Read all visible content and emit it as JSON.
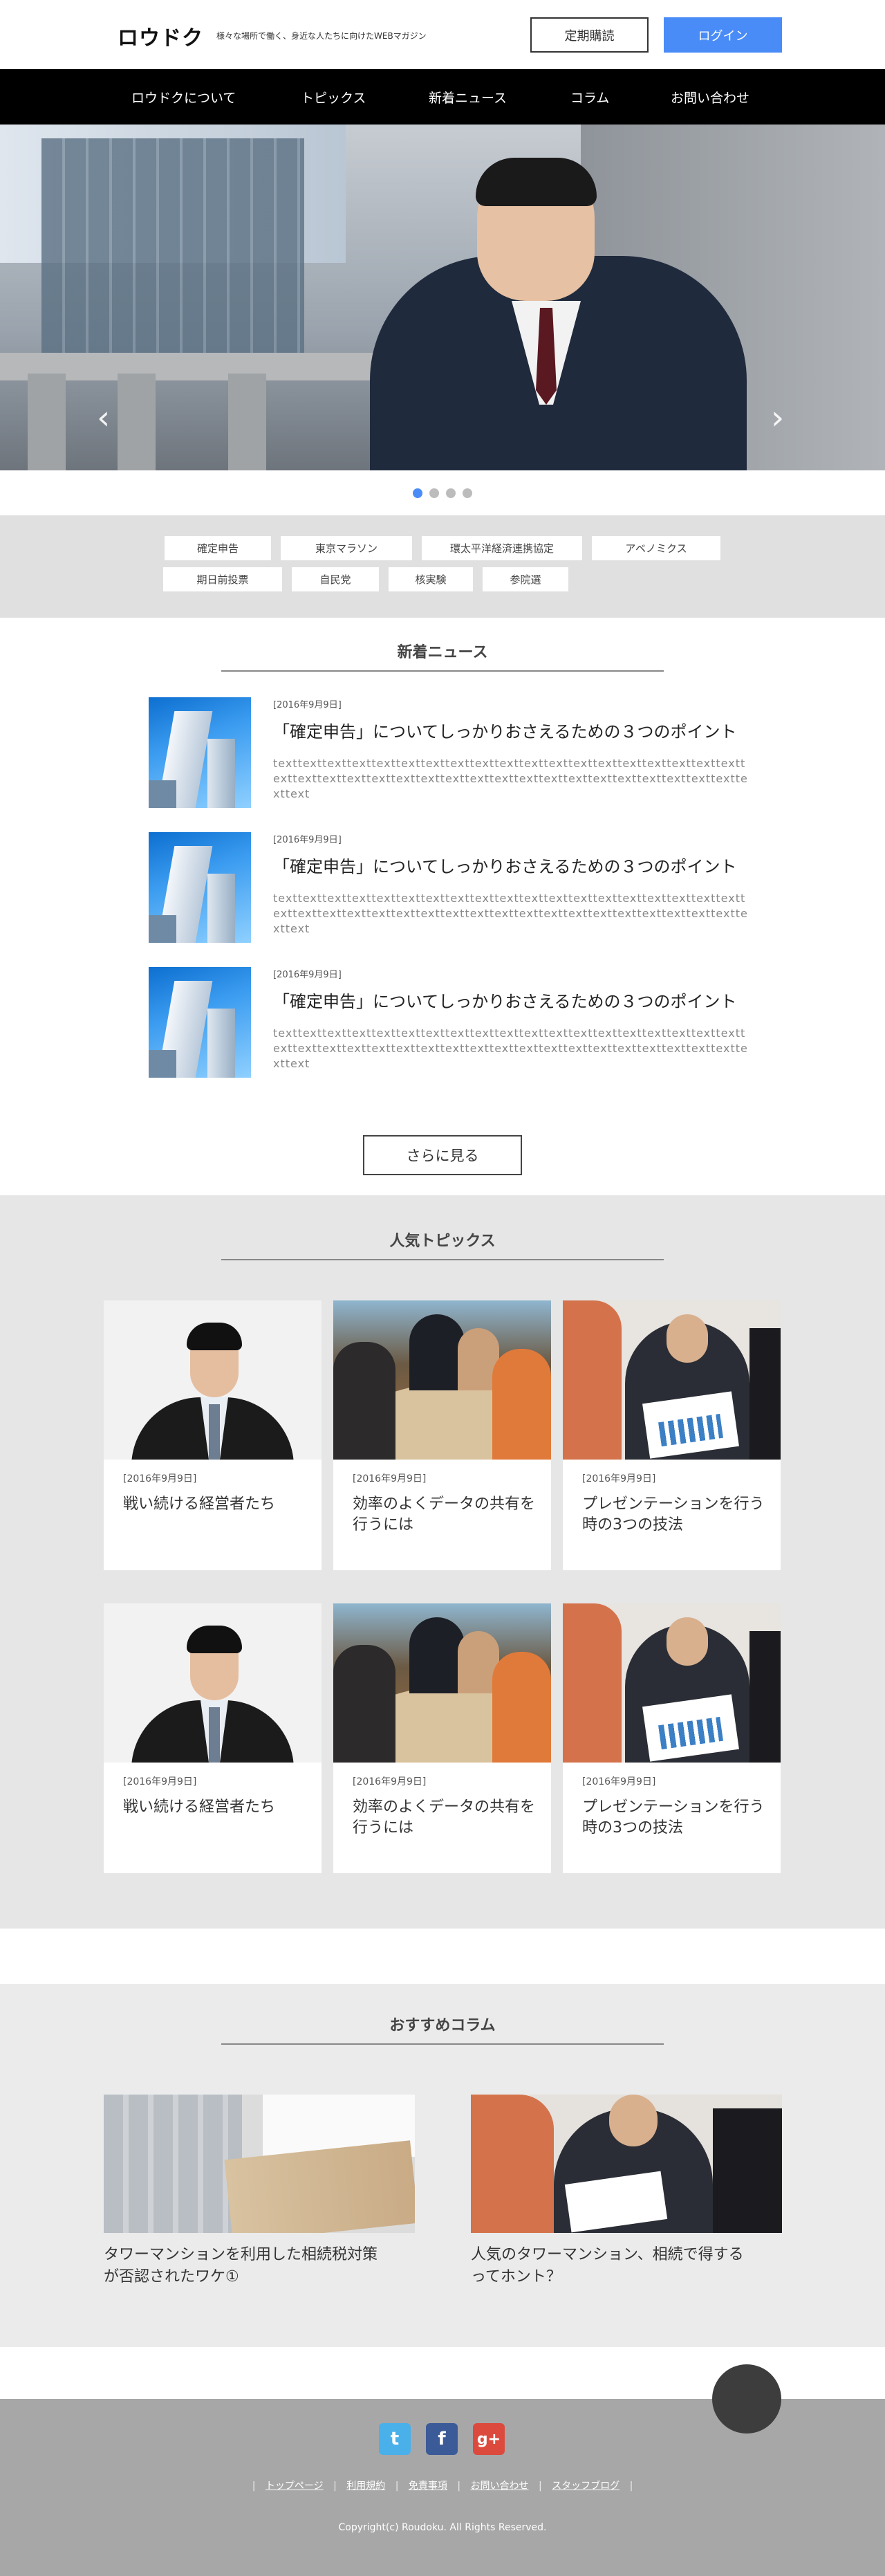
{
  "header": {
    "logo": "ロウドク",
    "tagline": "様々な場所で働く、身近な人たちに向けたWEBマガジン",
    "subscribe_label": "定期購読",
    "login_label": "ログイン"
  },
  "nav": {
    "items": [
      "ロウドクについて",
      "トピックス",
      "新着ニュース",
      "コラム",
      "お問い合わせ"
    ]
  },
  "hero": {
    "prev_glyph": "‹",
    "next_glyph": "›",
    "slide_count": 4,
    "active_slide": 1
  },
  "tags": {
    "row1": [
      "確定申告",
      "東京マラソン",
      "環太平洋経済連携協定",
      "アベノミクス"
    ],
    "row2": [
      "期日前投票",
      "自民党",
      "核実験",
      "参院選"
    ]
  },
  "news": {
    "title": "新着ニュース",
    "items": [
      {
        "date": "[2016年9月9日]",
        "title": "「確定申告」についてしっかりおさえるための３つのポイント",
        "body": "texttexttexttexttexttexttexttexttexttexttexttexttexttexttexttexttexttexttexttexttexttexttexttexttexttexttexttexttexttexttexttexttexttexttexttexttexttexttexttext"
      },
      {
        "date": "[2016年9月9日]",
        "title": "「確定申告」についてしっかりおさえるための３つのポイント",
        "body": "texttexttexttexttexttexttexttexttexttexttexttexttexttexttexttexttexttexttexttexttexttexttexttexttexttexttexttexttexttexttexttexttexttexttexttexttexttexttexttext"
      },
      {
        "date": "[2016年9月9日]",
        "title": "「確定申告」についてしっかりおさえるための３つのポイント",
        "body": "texttexttexttexttexttexttexttexttexttexttexttexttexttexttexttexttexttexttexttexttexttexttexttexttexttexttexttexttexttexttexttexttexttexttexttexttexttexttexttext"
      }
    ],
    "more_label": "さらに見る"
  },
  "topics": {
    "title": "人気トピックス",
    "items": [
      {
        "date": "[2016年9月9日]",
        "title": "戦い続ける経営者たち"
      },
      {
        "date": "[2016年9月9日]",
        "title": "効率のよくデータの共有を行うには"
      },
      {
        "date": "[2016年9月9日]",
        "title": "プレゼンテーションを行う時の3つの技法"
      },
      {
        "date": "[2016年9月9日]",
        "title": "戦い続ける経営者たち"
      },
      {
        "date": "[2016年9月9日]",
        "title": "効率のよくデータの共有を行うには"
      },
      {
        "date": "[2016年9月9日]",
        "title": "プレゼンテーションを行う時の3つの技法"
      }
    ]
  },
  "columns": {
    "title": "おすすめコラム",
    "items": [
      {
        "title": "タワーマンションを利用した相続税対策が否認されたワケ①"
      },
      {
        "title": "人気のタワーマンション、相続で得するってホント？"
      }
    ]
  },
  "footer": {
    "social": {
      "twitter": "t",
      "facebook": "f",
      "googleplus": "g+"
    },
    "links": [
      "トップページ",
      "利用規約",
      "免責事項",
      "お問い合わせ",
      "スタッフブログ"
    ],
    "copyright": "Copyright(c) Roudoku. All Rights Reserved."
  },
  "colors": {
    "accent": "#4a8cf7",
    "nav_bg": "#000000",
    "tags_bg": "#e0e0e0",
    "topics_bg": "#e6e6e6",
    "footer_bg": "#a7a7a7"
  }
}
